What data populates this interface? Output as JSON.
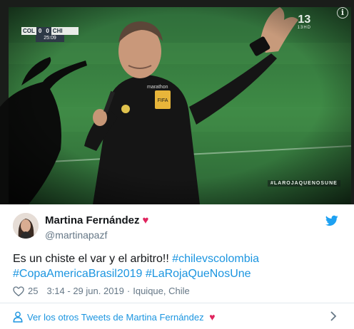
{
  "media": {
    "scoreboard": {
      "team_left": "COL",
      "score_left": "0",
      "score_right": "0",
      "team_right": "CHI",
      "clock": "25:09"
    },
    "channel": {
      "number": "13",
      "subtitle": "13HD"
    },
    "overlay_hashtag": "#LAROJAQUENOSUNE",
    "info_icon": "info-icon"
  },
  "tweet": {
    "author": {
      "display_name": "Martina Fernández",
      "emoji": "♥",
      "handle": "@martinapazf"
    },
    "text_plain": "Es un chiste el var y el arbitro!! ",
    "hashtags": [
      "#chilevscolombia",
      "#CopaAmericaBrasil2019",
      "#LaRojaQueNosUne"
    ],
    "likes": "25",
    "time": "3:14 - 29 jun. 2019",
    "separator": "·",
    "location": "Iquique, Chile"
  },
  "footer": {
    "label": "Ver los otros Tweets de Martina Fernández",
    "emoji": "♥"
  },
  "colors": {
    "link": "#1b95e0",
    "muted": "#657786",
    "heart": "#e0245e",
    "twitter_blue": "#1da1f2"
  }
}
